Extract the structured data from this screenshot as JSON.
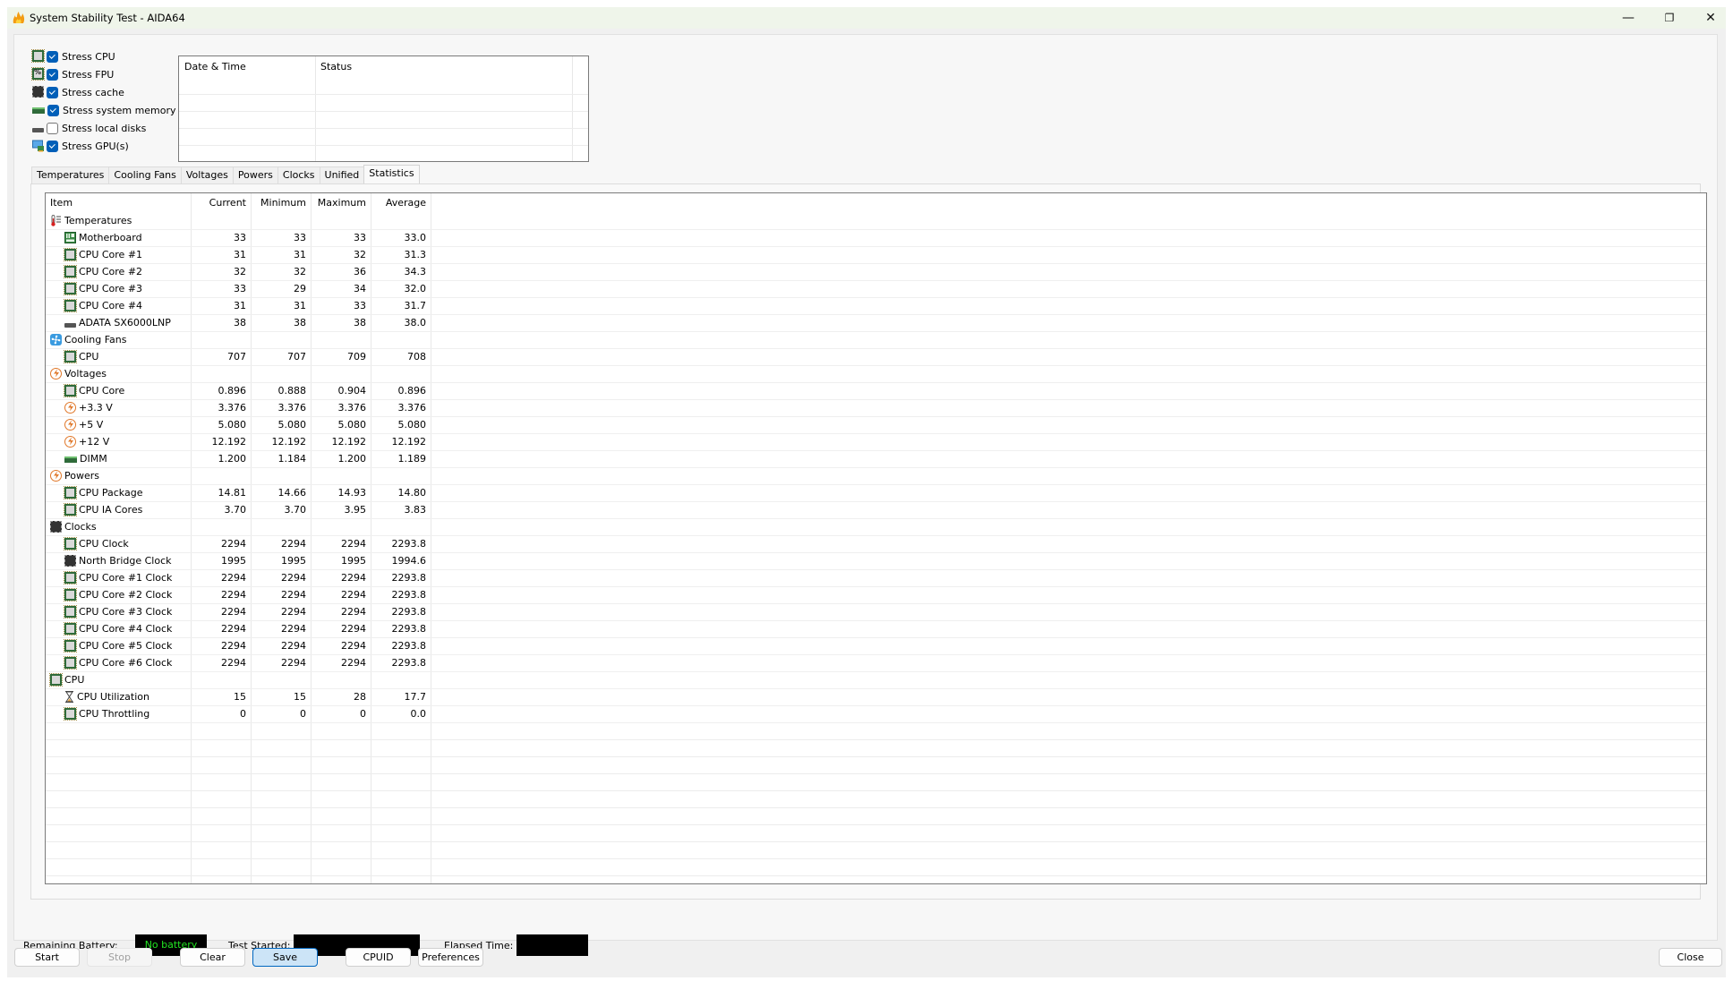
{
  "window": {
    "title": "System Stability Test - AIDA64",
    "controls": {
      "minimize": "—",
      "restore": "❐",
      "close": "✕"
    }
  },
  "stress_options": [
    {
      "label": "Stress CPU",
      "checked": true,
      "icon": "cpu-chip-icon"
    },
    {
      "label": "Stress FPU",
      "checked": true,
      "icon": "fpu-chip-icon"
    },
    {
      "label": "Stress cache",
      "checked": true,
      "icon": "cache-chip-icon"
    },
    {
      "label": "Stress system memory",
      "checked": true,
      "icon": "memory-module-icon"
    },
    {
      "label": "Stress local disks",
      "checked": false,
      "icon": "disk-drive-icon"
    },
    {
      "label": "Stress GPU(s)",
      "checked": true,
      "icon": "gpu-monitor-icon"
    }
  ],
  "log": {
    "columns": [
      "Date & Time",
      "Status"
    ],
    "rows": []
  },
  "tabs": [
    {
      "label": "Temperatures",
      "active": false
    },
    {
      "label": "Cooling Fans",
      "active": false
    },
    {
      "label": "Voltages",
      "active": false
    },
    {
      "label": "Powers",
      "active": false
    },
    {
      "label": "Clocks",
      "active": false
    },
    {
      "label": "Unified",
      "active": false
    },
    {
      "label": "Statistics",
      "active": true
    }
  ],
  "statistics": {
    "columns": [
      "Item",
      "Current",
      "Minimum",
      "Maximum",
      "Average"
    ],
    "rows": [
      {
        "type": "group",
        "icon": "thermometer-icon",
        "item": "Temperatures"
      },
      {
        "type": "item",
        "icon": "motherboard-icon",
        "item": "Motherboard",
        "current": "33",
        "minimum": "33",
        "maximum": "33",
        "average": "33.0"
      },
      {
        "type": "item",
        "icon": "cpu-chip-icon",
        "item": "CPU Core #1",
        "current": "31",
        "minimum": "31",
        "maximum": "32",
        "average": "31.3"
      },
      {
        "type": "item",
        "icon": "cpu-chip-icon",
        "item": "CPU Core #2",
        "current": "32",
        "minimum": "32",
        "maximum": "36",
        "average": "34.3"
      },
      {
        "type": "item",
        "icon": "cpu-chip-icon",
        "item": "CPU Core #3",
        "current": "33",
        "minimum": "29",
        "maximum": "34",
        "average": "32.0"
      },
      {
        "type": "item",
        "icon": "cpu-chip-icon",
        "item": "CPU Core #4",
        "current": "31",
        "minimum": "31",
        "maximum": "33",
        "average": "31.7"
      },
      {
        "type": "item",
        "icon": "disk-drive-icon",
        "item": "ADATA SX6000LNP",
        "current": "38",
        "minimum": "38",
        "maximum": "38",
        "average": "38.0"
      },
      {
        "type": "group",
        "icon": "fan-icon",
        "item": "Cooling Fans"
      },
      {
        "type": "item",
        "icon": "cpu-chip-icon",
        "item": "CPU",
        "current": "707",
        "minimum": "707",
        "maximum": "709",
        "average": "708"
      },
      {
        "type": "group",
        "icon": "lightning-icon",
        "item": "Voltages"
      },
      {
        "type": "item",
        "icon": "cpu-chip-icon",
        "item": "CPU Core",
        "current": "0.896",
        "minimum": "0.888",
        "maximum": "0.904",
        "average": "0.896"
      },
      {
        "type": "item",
        "icon": "lightning-icon",
        "item": "+3.3 V",
        "current": "3.376",
        "minimum": "3.376",
        "maximum": "3.376",
        "average": "3.376"
      },
      {
        "type": "item",
        "icon": "lightning-icon",
        "item": "+5 V",
        "current": "5.080",
        "minimum": "5.080",
        "maximum": "5.080",
        "average": "5.080"
      },
      {
        "type": "item",
        "icon": "lightning-icon",
        "item": "+12 V",
        "current": "12.192",
        "minimum": "12.192",
        "maximum": "12.192",
        "average": "12.192"
      },
      {
        "type": "item",
        "icon": "memory-module-icon",
        "item": "DIMM",
        "current": "1.200",
        "minimum": "1.184",
        "maximum": "1.200",
        "average": "1.189"
      },
      {
        "type": "group",
        "icon": "lightning-icon",
        "item": "Powers"
      },
      {
        "type": "item",
        "icon": "cpu-chip-icon",
        "item": "CPU Package",
        "current": "14.81",
        "minimum": "14.66",
        "maximum": "14.93",
        "average": "14.80"
      },
      {
        "type": "item",
        "icon": "cpu-chip-icon",
        "item": "CPU IA Cores",
        "current": "3.70",
        "minimum": "3.70",
        "maximum": "3.95",
        "average": "3.83"
      },
      {
        "type": "group",
        "icon": "cache-chip-icon",
        "item": "Clocks"
      },
      {
        "type": "item",
        "icon": "cpu-chip-icon",
        "item": "CPU Clock",
        "current": "2294",
        "minimum": "2294",
        "maximum": "2294",
        "average": "2293.8"
      },
      {
        "type": "item",
        "icon": "cache-chip-icon",
        "item": "North Bridge Clock",
        "current": "1995",
        "minimum": "1995",
        "maximum": "1995",
        "average": "1994.6"
      },
      {
        "type": "item",
        "icon": "cpu-chip-icon",
        "item": "CPU Core #1 Clock",
        "current": "2294",
        "minimum": "2294",
        "maximum": "2294",
        "average": "2293.8"
      },
      {
        "type": "item",
        "icon": "cpu-chip-icon",
        "item": "CPU Core #2 Clock",
        "current": "2294",
        "minimum": "2294",
        "maximum": "2294",
        "average": "2293.8"
      },
      {
        "type": "item",
        "icon": "cpu-chip-icon",
        "item": "CPU Core #3 Clock",
        "current": "2294",
        "minimum": "2294",
        "maximum": "2294",
        "average": "2293.8"
      },
      {
        "type": "item",
        "icon": "cpu-chip-icon",
        "item": "CPU Core #4 Clock",
        "current": "2294",
        "minimum": "2294",
        "maximum": "2294",
        "average": "2293.8"
      },
      {
        "type": "item",
        "icon": "cpu-chip-icon",
        "item": "CPU Core #5 Clock",
        "current": "2294",
        "minimum": "2294",
        "maximum": "2294",
        "average": "2293.8"
      },
      {
        "type": "item",
        "icon": "cpu-chip-icon",
        "item": "CPU Core #6 Clock",
        "current": "2294",
        "minimum": "2294",
        "maximum": "2294",
        "average": "2293.8"
      },
      {
        "type": "group",
        "icon": "cpu-chip-icon",
        "item": "CPU"
      },
      {
        "type": "item",
        "icon": "hourglass-icon",
        "item": "CPU Utilization",
        "current": "15",
        "minimum": "15",
        "maximum": "28",
        "average": "17.7"
      },
      {
        "type": "item",
        "icon": "cpu-chip-icon",
        "item": "CPU Throttling",
        "current": "0",
        "minimum": "0",
        "maximum": "0",
        "average": "0.0"
      }
    ]
  },
  "status_bar": {
    "battery_label": "Remaining Battery:",
    "battery_value": "No battery",
    "test_started_label": "Test Started:",
    "test_started_value": "",
    "elapsed_label": "Elapsed Time:",
    "elapsed_value": ""
  },
  "buttons": {
    "start": "Start",
    "stop": "Stop",
    "clear": "Clear",
    "save": "Save",
    "cpuid": "CPUID",
    "preferences": "Preferences",
    "close": "Close"
  },
  "colors": {
    "titlebar_bg": "#eff5ea",
    "checkbox_accent": "#005fb8",
    "battery_text": "#22e322",
    "save_button_bg": "#cce4f7",
    "save_button_border": "#0067c0"
  }
}
